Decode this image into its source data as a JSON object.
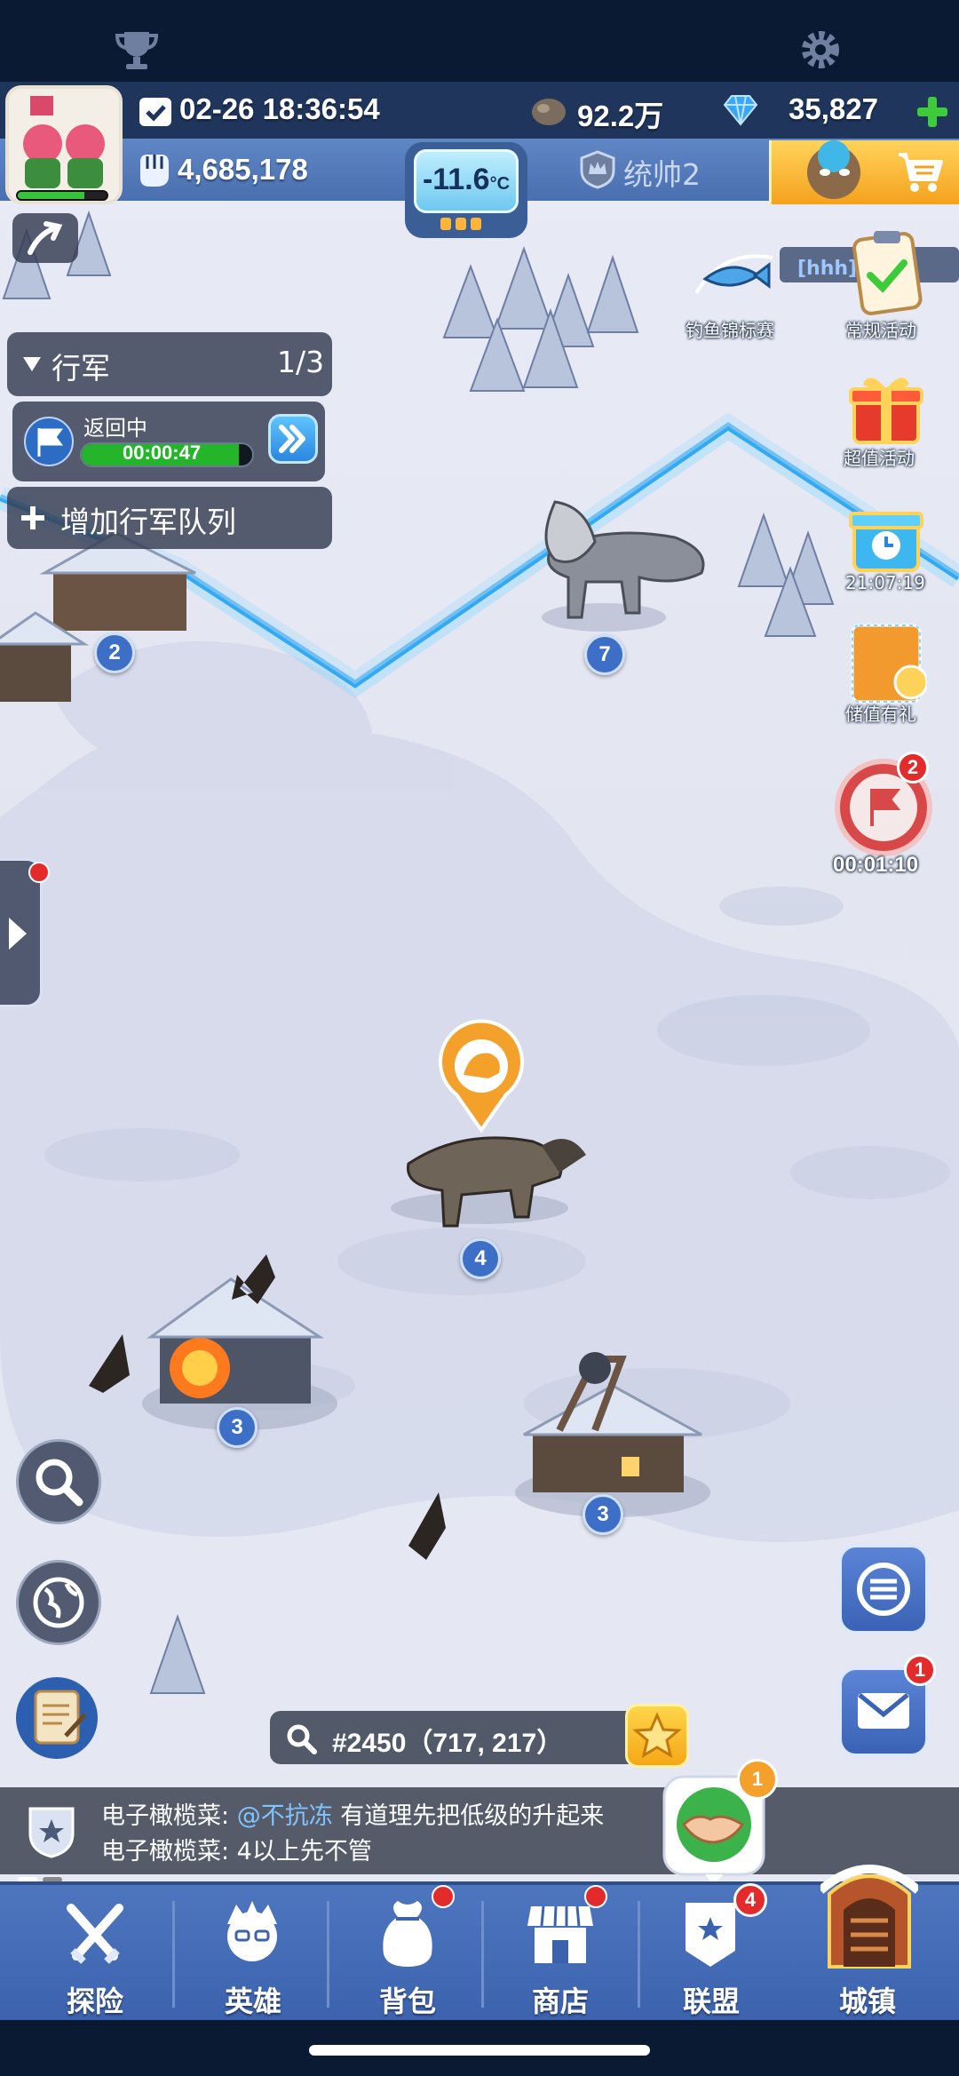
{
  "resources": {
    "timestamp": "02-26 18:36:54",
    "stone": "92.2万",
    "gems": "35,827",
    "power": "4,685,178",
    "temperature": "-11.6",
    "temperature_unit": "°C",
    "rank": "统帅2"
  },
  "alliance_tag": "[hhh]联",
  "march": {
    "title": "行军",
    "count": "1/3",
    "status": "返回中",
    "timer": "00:00:47",
    "progress": 0.92,
    "add_queue": "增加行军队列"
  },
  "events": {
    "fishing": "钓鱼锦标赛",
    "regular": "常规活动",
    "value": "超值活动",
    "timer_gift": "21:07:19",
    "recharge": "储值有礼",
    "rally_timer": "00:01:10",
    "rally_badge": "2"
  },
  "map": {
    "levels": [
      "2",
      "7",
      "4",
      "3",
      "3"
    ]
  },
  "coords": {
    "text": "#2450（717, 217）"
  },
  "chat": {
    "line1_name": "电子橄榄菜:",
    "line1_mention": "@不抗冻",
    "line1_text": " 有道理先把低级的升起来",
    "line2": "电子橄榄菜: 4以上先不管",
    "help_badge": "1"
  },
  "mail_badge": "1",
  "nav": {
    "items": [
      {
        "label": "探险"
      },
      {
        "label": "英雄"
      },
      {
        "label": "背包"
      },
      {
        "label": "商店"
      },
      {
        "label": "联盟",
        "badge": "4"
      },
      {
        "label": "城镇"
      }
    ]
  },
  "colors": {
    "accent": "#3d6fc7",
    "badge_red": "#e32b2b",
    "gold": "#f5a21e",
    "progress_green": "#25b52a"
  }
}
